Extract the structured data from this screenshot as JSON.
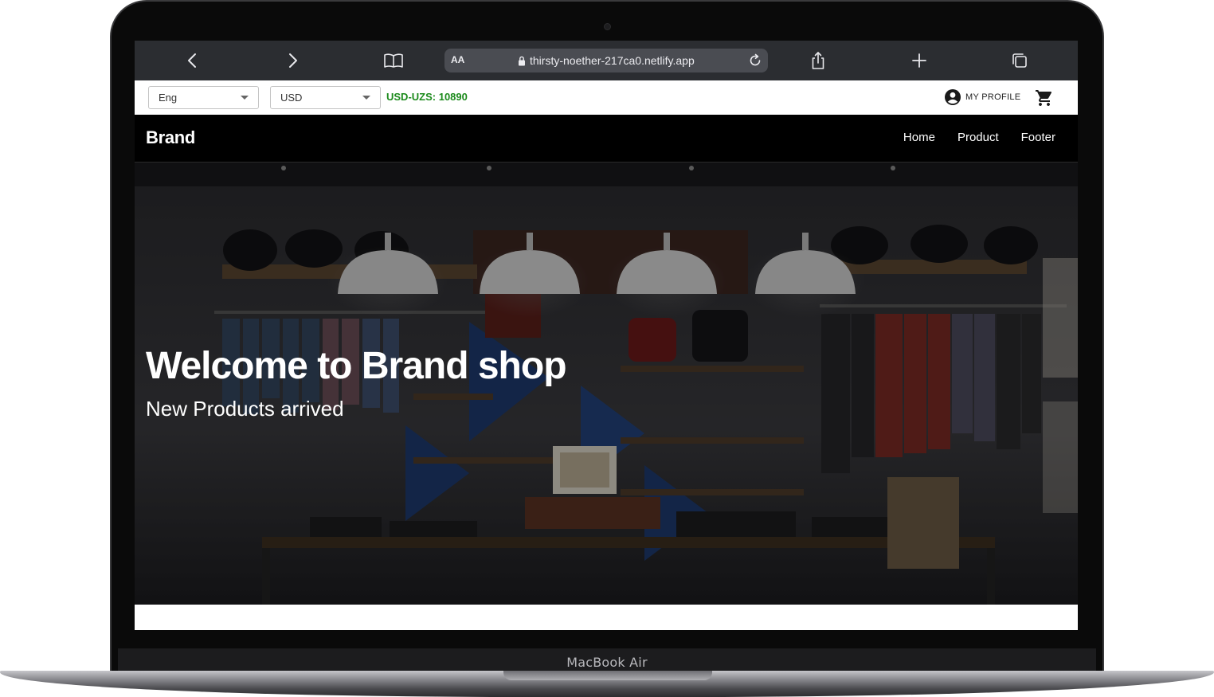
{
  "device": {
    "model_label": "MacBook Air"
  },
  "browser": {
    "text_size_label": "AA",
    "url": "thirsty-noether-217ca0.netlify.app",
    "icons": {
      "back": "chevron-left-icon",
      "forward": "chevron-right-icon",
      "bookmarks": "book-icon",
      "secure": "lock-icon",
      "reload": "reload-icon",
      "share": "share-icon",
      "new_tab": "plus-icon",
      "tabs": "tabs-icon"
    }
  },
  "util_bar": {
    "language_select": {
      "value": "Eng"
    },
    "currency_select": {
      "value": "USD"
    },
    "exchange_rate": "USD-UZS: 10890",
    "profile_label": "MY PROFILE",
    "colors": {
      "rate_text": "#1b8a1b"
    }
  },
  "navbar": {
    "brand": "Brand",
    "links": [
      "Home",
      "Product",
      "Footer"
    ]
  },
  "hero": {
    "title": "Welcome to Brand shop",
    "subtitle": "New Products arrived"
  }
}
